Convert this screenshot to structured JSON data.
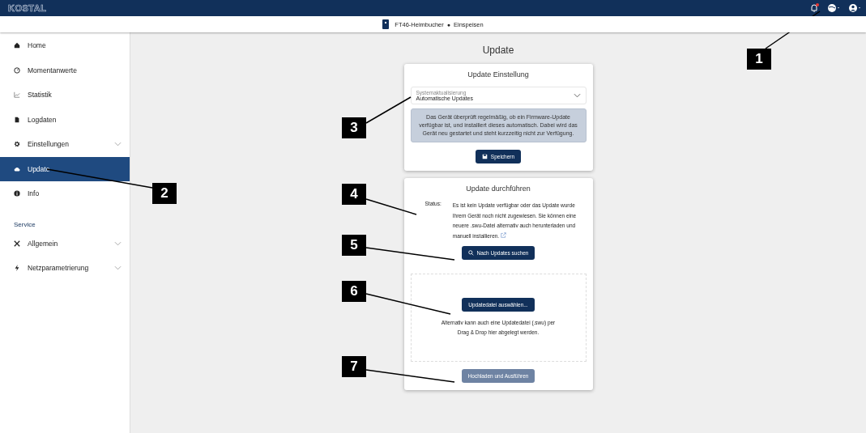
{
  "header": {
    "logo": "KOSTAL",
    "notifications": {
      "unread": true
    }
  },
  "device_bar": {
    "device": "FT46-Heimbucher",
    "separator": "●",
    "mode": "Einspeisen"
  },
  "sidebar": {
    "items": [
      {
        "label": "Home",
        "selected": false,
        "has_submenu": false
      },
      {
        "label": "Momentanwerte",
        "selected": false,
        "has_submenu": false
      },
      {
        "label": "Statistik",
        "selected": false,
        "has_submenu": false
      },
      {
        "label": "Logdaten",
        "selected": false,
        "has_submenu": false
      },
      {
        "label": "Einstellungen",
        "selected": false,
        "has_submenu": true
      },
      {
        "label": "Update",
        "selected": true,
        "has_submenu": false
      },
      {
        "label": "Info",
        "selected": false,
        "has_submenu": false
      }
    ],
    "section": "Service",
    "service_items": [
      {
        "label": "Allgemein",
        "selected": false,
        "has_submenu": true
      },
      {
        "label": "Netzparametrierung",
        "selected": false,
        "has_submenu": true
      }
    ]
  },
  "page_title": "Update",
  "settings_card": {
    "title": "Update Einstellung",
    "select": {
      "label": "Systemaktualisierung",
      "value": "Automatische Updates"
    },
    "info": "Das Gerät überprüft regelmäßig, ob ein Firmware-Update verfügbar ist, und installiert dieses automatisch. Dabei wird das Gerät neu gestartet und steht kurzzeitig nicht zur Verfügung.",
    "save_button": {
      "label": "Speichern",
      "disabled": false
    }
  },
  "update_card": {
    "title": "Update durchführen",
    "status_label": "Status:",
    "status_text": "Es ist kein Update verfügbar oder das Update wurde Ihrem Gerät noch nicht zugewiesen. Sie können eine neuere .swu-Datei alternativ auch herunterladen und manuell installieren.",
    "search_button": {
      "label": "Nach Updates suchen",
      "disabled": false
    },
    "choose_button": {
      "label": "Updatedatei auswählen...",
      "disabled": false
    },
    "drop_hint": "Alternativ kann auch eine Updatedatei (.swu) per Drag & Drop hier abgelegt werden.",
    "upload_button": {
      "label": "Hochladen und Ausführen",
      "disabled": true
    }
  },
  "callouts": [
    {
      "label": "1"
    },
    {
      "label": "2"
    },
    {
      "label": "3"
    },
    {
      "label": "4"
    },
    {
      "label": "5"
    },
    {
      "label": "6"
    },
    {
      "label": "7"
    }
  ]
}
